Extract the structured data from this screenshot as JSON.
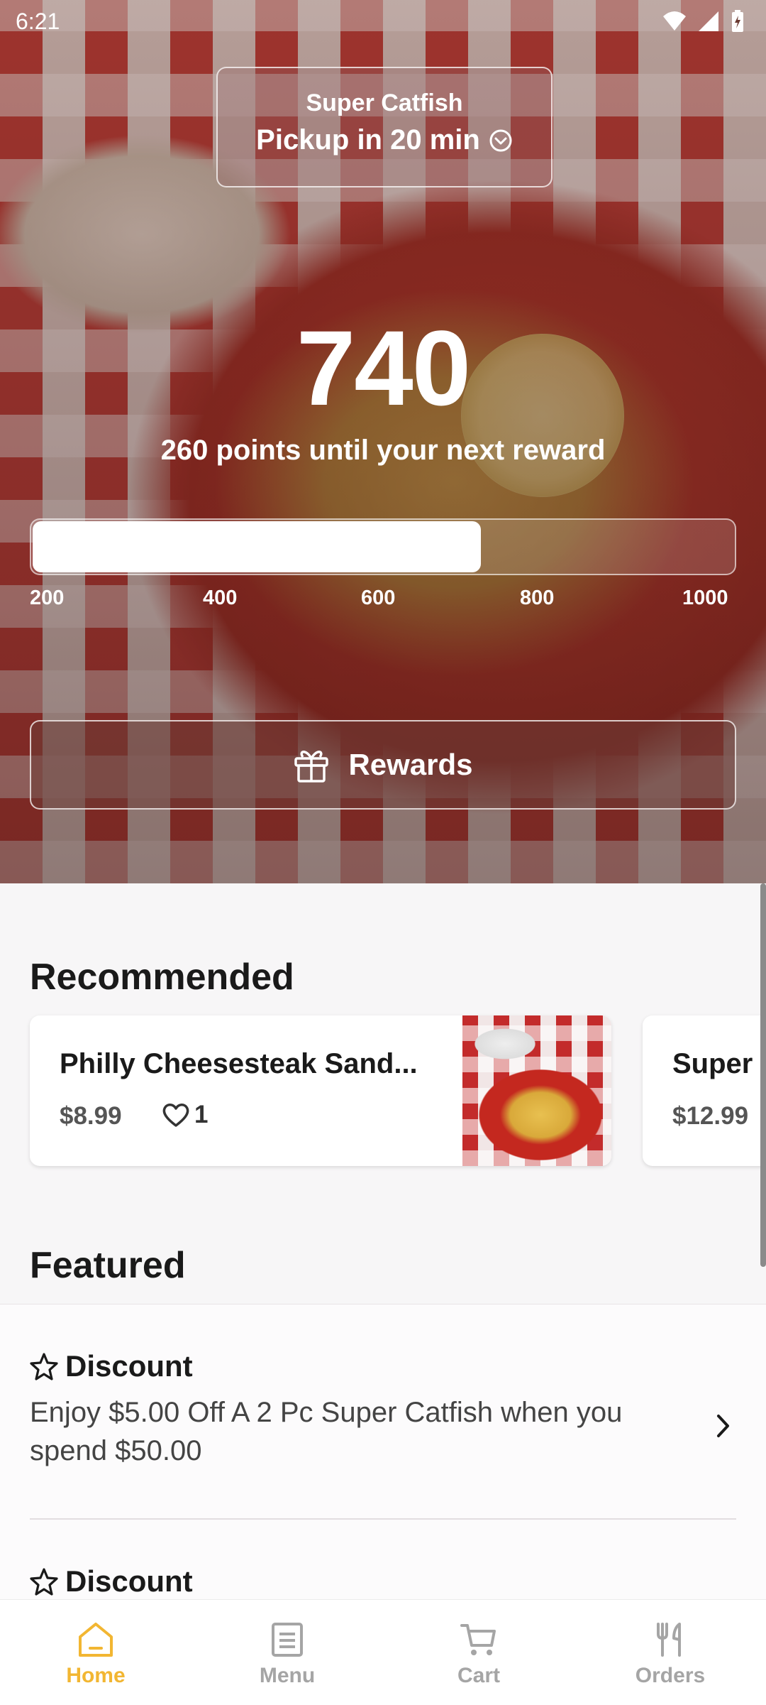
{
  "status_bar": {
    "time": "6:21",
    "icons": [
      "wifi-icon",
      "signal-icon",
      "battery-charging-icon"
    ]
  },
  "header": {
    "store_name": "Super Catfish",
    "pickup_label": "Pickup in 20 min",
    "pickup_icon": "chevron-circle-down-icon"
  },
  "rewards": {
    "points": "740",
    "next_reward_text": "260 points until your next reward",
    "progress_fraction": 0.64,
    "ticks": [
      "200",
      "400",
      "600",
      "800",
      "1000"
    ],
    "button_label": "Rewards",
    "button_icon": "gift-icon"
  },
  "recommended": {
    "title": "Recommended",
    "items": [
      {
        "name": "Philly Cheesesteak Sand...",
        "price": "$8.99",
        "likes": "1"
      },
      {
        "name": "Super",
        "price": "$12.99"
      }
    ]
  },
  "featured": {
    "title": "Featured",
    "items": [
      {
        "title": "Discount",
        "description": "Enjoy $5.00 Off A 2 Pc Super Catfish when you spend $50.00"
      },
      {
        "title": "Discount"
      }
    ]
  },
  "bottom_nav": {
    "items": [
      {
        "label": "Home",
        "icon": "home-icon",
        "active": true
      },
      {
        "label": "Menu",
        "icon": "menu-list-icon",
        "active": false
      },
      {
        "label": "Cart",
        "icon": "cart-icon",
        "active": false
      },
      {
        "label": "Orders",
        "icon": "fork-knife-icon",
        "active": false
      }
    ]
  },
  "colors": {
    "accent": "#f2b632",
    "inactive": "#a5a5a5",
    "hero_red": "#c23a36"
  }
}
